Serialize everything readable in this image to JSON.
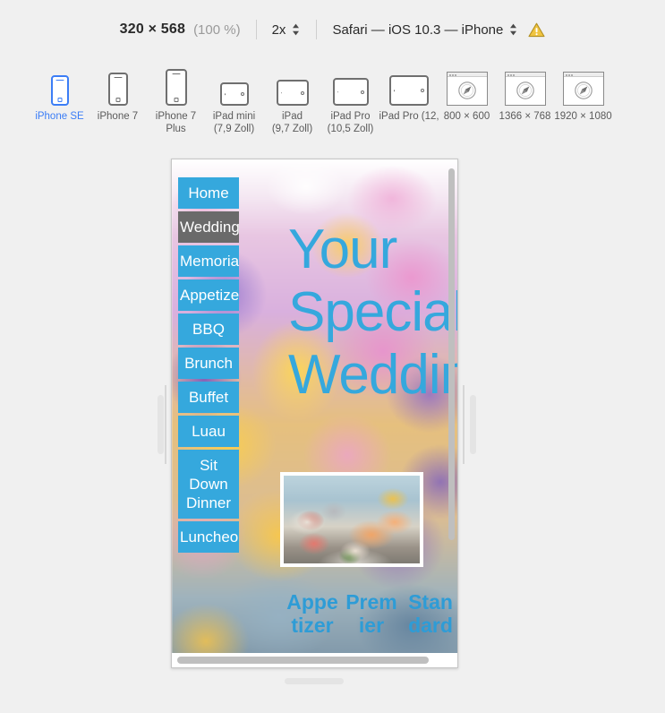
{
  "toolbar": {
    "dimensions": "320 × 568",
    "zoom_percent": "(100 %)",
    "scale": "2x",
    "user_agent": "Safari — iOS 10.3 — iPhone",
    "warning_icon": "warning-triangle-icon",
    "scale_stepper_icon": "stepper-chevrons-icon",
    "ua_stepper_icon": "stepper-chevrons-icon"
  },
  "devices": [
    {
      "label": "iPhone SE",
      "type": "phone",
      "selected": true
    },
    {
      "label": "iPhone 7",
      "type": "phone",
      "selected": false
    },
    {
      "label": "iPhone 7\nPlus",
      "type": "phone",
      "selected": false
    },
    {
      "label": "iPad mini\n(7,9 Zoll)",
      "type": "tablet",
      "selected": false
    },
    {
      "label": "iPad\n(9,7 Zoll)",
      "type": "tablet",
      "selected": false
    },
    {
      "label": "iPad Pro\n(10,5 Zoll)",
      "type": "tablet",
      "selected": false
    },
    {
      "label": "iPad Pro (12,",
      "type": "tablet",
      "selected": false
    },
    {
      "label": "800 × 600",
      "type": "desktop",
      "selected": false
    },
    {
      "label": "1366 × 768",
      "type": "desktop",
      "selected": false
    },
    {
      "label": "1920 × 1080",
      "type": "desktop",
      "selected": false
    }
  ],
  "preview": {
    "nav_items": [
      {
        "label": "Home",
        "active": false
      },
      {
        "label": "Weddings",
        "active": true
      },
      {
        "label": "Memorial",
        "active": false
      },
      {
        "label": "Appetizer",
        "active": false
      },
      {
        "label": "BBQ",
        "active": false
      },
      {
        "label": "Brunch",
        "active": false
      },
      {
        "label": "Buffet",
        "active": false
      },
      {
        "label": "Luau",
        "active": false
      },
      {
        "label": "Sit Down Dinner",
        "active": false
      },
      {
        "label": "Luncheon",
        "active": false
      }
    ],
    "headline": "Your Special Wedding",
    "columns": [
      "Appetizer",
      "Premier",
      "Standard"
    ],
    "photo_alt": "shrimp-plate-photo",
    "accent_color": "#35a8dd",
    "active_nav_color": "#6a6a6a"
  }
}
